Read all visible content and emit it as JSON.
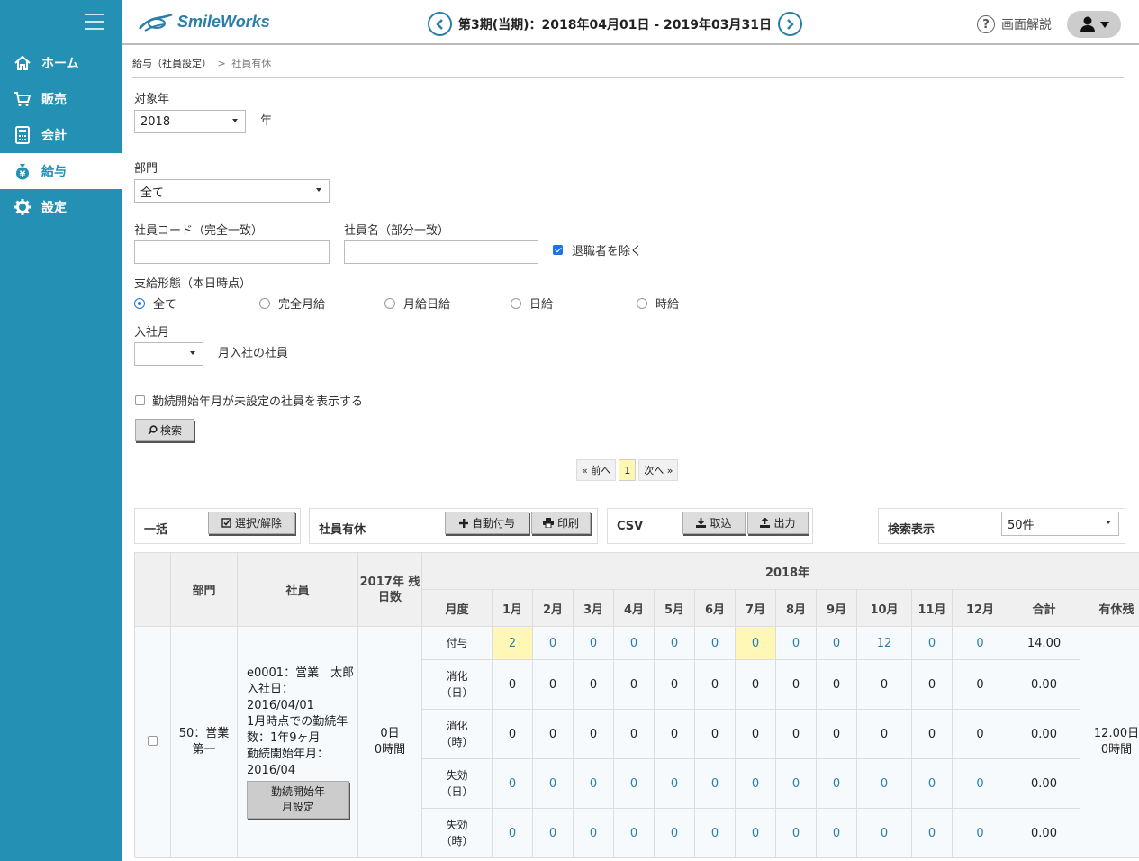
{
  "app": {
    "logo_text": "SmileWorks"
  },
  "header": {
    "period": "第3期(当期)：2018年04月01日 - 2019年03月31日",
    "help_label": "画面解説"
  },
  "sidebar": {
    "items": [
      {
        "label": "ホーム",
        "icon": "home-icon"
      },
      {
        "label": "販売",
        "icon": "cart-icon"
      },
      {
        "label": "会計",
        "icon": "calculator-icon"
      },
      {
        "label": "給与",
        "icon": "money-bag-icon",
        "active": true
      },
      {
        "label": "設定",
        "icon": "gear-icon"
      }
    ]
  },
  "breadcrumb": {
    "parent": "給与（社員設定）",
    "separator": ">",
    "current": "社員有休"
  },
  "form": {
    "year_label": "対象年",
    "year_value": "2018",
    "year_suffix": "年",
    "dept_label": "部門",
    "dept_value": "全て",
    "code_label": "社員コード（完全一致）",
    "name_label": "社員名（部分一致）",
    "exclude_retired_label": "退職者を除く",
    "pay_type_label": "支給形態（本日時点）",
    "pay_types": [
      "全て",
      "完全月給",
      "月給日給",
      "日給",
      "時給"
    ],
    "hire_month_label": "入社月",
    "hire_month_suffix": "月入社の社員",
    "unset_start_label": "勤続開始年月が未設定の社員を表示する",
    "search_button": "検索"
  },
  "pager": {
    "prev": "« 前へ",
    "current": "1",
    "next": "次へ »"
  },
  "panels": {
    "bulk": {
      "title": "一括",
      "button": "選択/解除"
    },
    "leave": {
      "title": "社員有休",
      "auto_button": "自動付与",
      "print_button": "印刷"
    },
    "csv": {
      "title": "CSV",
      "import_button": "取込",
      "export_button": "出力"
    },
    "display": {
      "title": "検索表示",
      "value": "50件"
    }
  },
  "table": {
    "headers": {
      "dept": "部門",
      "employee": "社員",
      "prev_year_remaining": "2017年 残日数",
      "year": "2018年",
      "month_type": "月度",
      "months": [
        "1月",
        "2月",
        "3月",
        "4月",
        "5月",
        "6月",
        "7月",
        "8月",
        "9月",
        "10月",
        "11月",
        "12月"
      ],
      "total": "合計",
      "remaining": "有休残"
    },
    "rows": [
      {
        "dept": "50：営業　第一",
        "employee_lines": [
          "e0001：営業　太郎",
          "入社日：2016/04/01",
          "1月時点での勤続年数：1年9ヶ月",
          "勤続開始年月：2016/04"
        ],
        "employee_button": "勤続開始年月設定",
        "prev_remaining": "0日\n0時間",
        "remaining": "12.00日\n0時間",
        "lines": [
          {
            "label": "付与",
            "values": [
              "2",
              "0",
              "0",
              "0",
              "0",
              "0",
              "0",
              "0",
              "0",
              "12",
              "0",
              "0"
            ],
            "total": "14.00"
          },
          {
            "label": "消化\n（日）",
            "values": [
              "0",
              "0",
              "0",
              "0",
              "0",
              "0",
              "0",
              "0",
              "0",
              "0",
              "0",
              "0"
            ],
            "total": "0.00"
          },
          {
            "label": "消化\n（時）",
            "values": [
              "0",
              "0",
              "0",
              "0",
              "0",
              "0",
              "0",
              "0",
              "0",
              "0",
              "0",
              "0"
            ],
            "total": "0.00"
          },
          {
            "label": "失効\n（日）",
            "values": [
              "0",
              "0",
              "0",
              "0",
              "0",
              "0",
              "0",
              "0",
              "0",
              "0",
              "0",
              "0"
            ],
            "total": "0.00"
          },
          {
            "label": "失効\n（時）",
            "values": [
              "0",
              "0",
              "0",
              "0",
              "0",
              "0",
              "0",
              "0",
              "0",
              "0",
              "0",
              "0"
            ],
            "total": "0.00"
          }
        ]
      }
    ]
  }
}
